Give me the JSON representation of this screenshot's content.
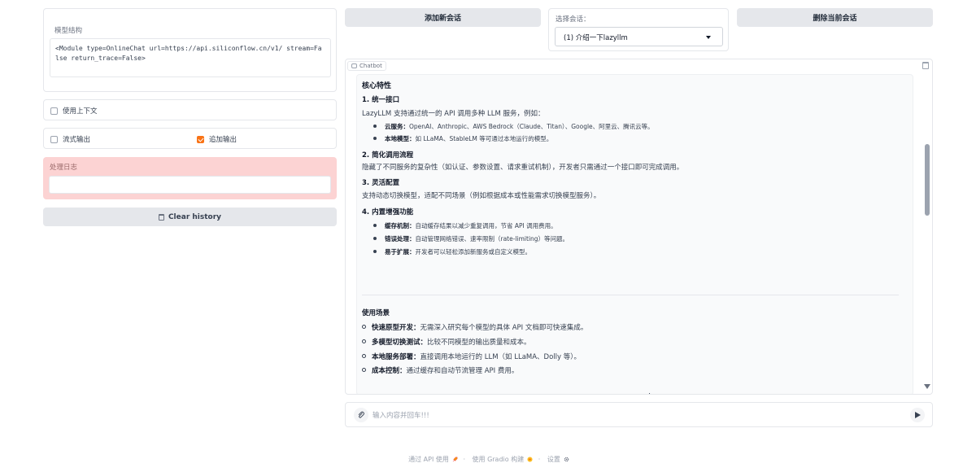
{
  "model_structure": {
    "label": "模型结构",
    "code": "<Module type=OnlineChat url=https://api.siliconflow.cn/v1/ stream=False return_trace=False>"
  },
  "options": {
    "use_context": {
      "label": "使用上下文",
      "checked": false
    },
    "stream_output": {
      "label": "流式输出",
      "checked": false
    },
    "append_output": {
      "label": "追加输出",
      "checked": true
    }
  },
  "log": {
    "label": "处理日志",
    "value": ""
  },
  "clear_history_label": "Clear history",
  "top_bar": {
    "add_session_label": "添加新会话",
    "delete_session_label": "删除当前会话",
    "select_label": "选择会话：",
    "selected_session": "(1) 介绍一下lazyllm"
  },
  "chatbot": {
    "tag": "Chatbot",
    "heading": "核心特性",
    "sections": [
      {
        "title": "1. 统一接口",
        "body": "LazyLLM 支持通过统一的 API 调用多种 LLM 服务，例如：",
        "bullets": [
          {
            "bold": "云服务：",
            "text": "OpenAI、Anthropic、AWS Bedrock（Claude、Titan）、Google、阿里云、腾讯云等。"
          },
          {
            "bold": "本地模型：",
            "text": "如 LLaMA、StableLM 等可通过本地运行的模型。"
          }
        ]
      },
      {
        "title": "2. 简化调用流程",
        "body": "隐藏了不同服务的复杂性（如认证、参数设置、请求重试机制），开发者只需通过一个接口即可完成调用。",
        "bullets": []
      },
      {
        "title": "3. 灵活配置",
        "body": "支持动态切换模型，适配不同场景（例如根据成本或性能需求切换模型服务）。",
        "bullets": []
      },
      {
        "title": "4. 内置增强功能",
        "body": "",
        "bullets": [
          {
            "bold": "缓存机制：",
            "text": "自动缓存结果以减少重复调用，节省 API 调用费用。"
          },
          {
            "bold": "错误处理：",
            "text": "自动管理网络错误、速率限制（rate-limiting）等问题。"
          },
          {
            "bold": "易于扩展：",
            "text": "开发者可以轻松添加新服务或自定义模型。"
          }
        ]
      }
    ],
    "usage_heading": "使用场景",
    "usage": [
      {
        "bold": "快速原型开发：",
        "text": "无需深入研究每个模型的具体 API 文档即可快速集成。"
      },
      {
        "bold": "多模型切换测试：",
        "text": "比较不同模型的输出质量和成本。"
      },
      {
        "bold": "本地服务部署：",
        "text": "直接调用本地运行的 LLM（如 LLaMA、Dolly 等）。"
      },
      {
        "bold": "成本控制：",
        "text": "通过缓存和自动节流管理 API 费用。"
      }
    ],
    "scroll_position": 0.28
  },
  "input": {
    "placeholder": "输入内容并回车!!!",
    "value": ""
  },
  "footer": {
    "api_text": "通过 API 使用",
    "gradio_text": "使用 Gradio 构建",
    "settings_text": "设置",
    "sep": "·"
  },
  "colors": {
    "accent": "#f97316",
    "log_bg": "#fcd3d3",
    "button_bg": "#e5e7eb"
  }
}
